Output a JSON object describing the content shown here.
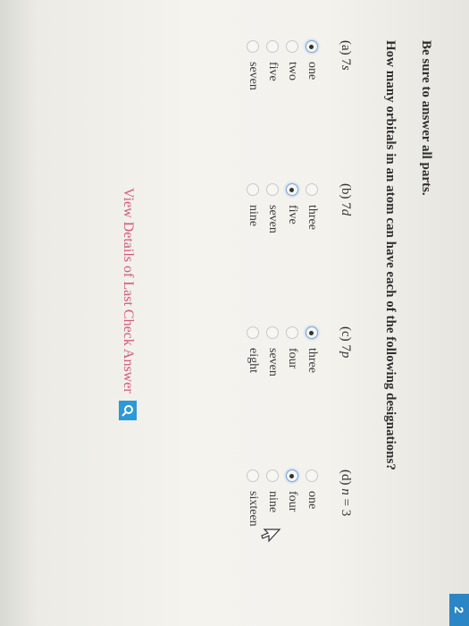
{
  "header": {
    "badge": "2"
  },
  "instruction": "Be sure to answer all parts.",
  "question": "How many orbitals in an atom can have each of the following designations?",
  "parts": [
    {
      "label_prefix": "(a) 7",
      "label_var": "s",
      "label_suffix": "",
      "options": [
        "one",
        "two",
        "five",
        "seven"
      ],
      "selected": 0
    },
    {
      "label_prefix": "(b) 7",
      "label_var": "d",
      "label_suffix": "",
      "options": [
        "three",
        "five",
        "seven",
        "nine"
      ],
      "selected": 1
    },
    {
      "label_prefix": "(c) 7",
      "label_var": "p",
      "label_suffix": "",
      "options": [
        "three",
        "four",
        "seven",
        "eight"
      ],
      "selected": 0
    },
    {
      "label_prefix": "(d) ",
      "label_var": "n",
      "label_suffix": " = 3",
      "options": [
        "one",
        "four",
        "nine",
        "sixteen"
      ],
      "selected": 1
    }
  ],
  "details_link": "View Details of Last Check Answer",
  "icons": {
    "magnifier": "search-icon",
    "pointer": "cursor-icon"
  },
  "colors": {
    "link": "#d25a7a",
    "accent": "#2b9ad6"
  }
}
